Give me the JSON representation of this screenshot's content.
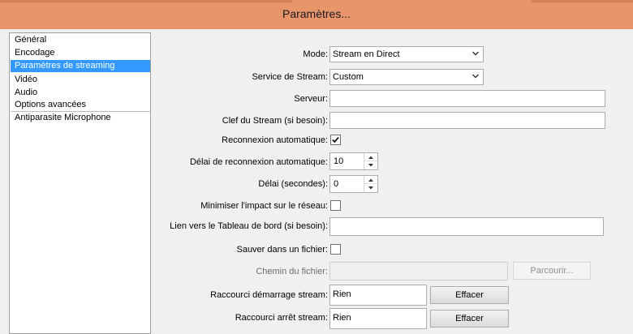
{
  "window": {
    "title": "Paramètres..."
  },
  "sidebar": {
    "items": [
      {
        "label": "Général"
      },
      {
        "label": "Encodage"
      },
      {
        "label": "Paramètres de streaming",
        "selected": true
      },
      {
        "label": "Vidéo"
      },
      {
        "label": "Audio"
      },
      {
        "label": "Options avancées"
      },
      {
        "label": "Antiparasite Microphone"
      }
    ]
  },
  "form": {
    "mode": {
      "label": "Mode:",
      "value": "Stream en Direct"
    },
    "service": {
      "label": "Service de Stream:",
      "value": "Custom"
    },
    "server": {
      "label": "Serveur:",
      "value": ""
    },
    "stream_key": {
      "label": "Clef du Stream (si besoin):",
      "value": ""
    },
    "auto_reconnect": {
      "label": "Reconnexion automatique:",
      "checked": true
    },
    "reconnect_delay": {
      "label": "Délai de reconnexion automatique:",
      "value": "10"
    },
    "delay": {
      "label": "Délai (secondes):",
      "value": "0"
    },
    "minimize_impact": {
      "label": "Minimiser l'impact sur le réseau:",
      "checked": false
    },
    "dashboard_link": {
      "label": "Lien vers le Tableau de bord (si besoin):",
      "value": ""
    },
    "save_to_file": {
      "label": "Sauver dans un fichier:",
      "checked": false
    },
    "file_path": {
      "label": "Chemin du fichier:",
      "value": "",
      "browse_label": "Parcourir..."
    },
    "start_hotkey": {
      "label": "Raccourci démarrage stream:",
      "value": "Rien",
      "clear_label": "Effacer"
    },
    "stop_hotkey": {
      "label": "Raccourci arrêt stream:",
      "value": "Rien",
      "clear_label": "Effacer"
    }
  },
  "colors": {
    "titlebar": "#e8956b",
    "selection": "#3399ff"
  }
}
